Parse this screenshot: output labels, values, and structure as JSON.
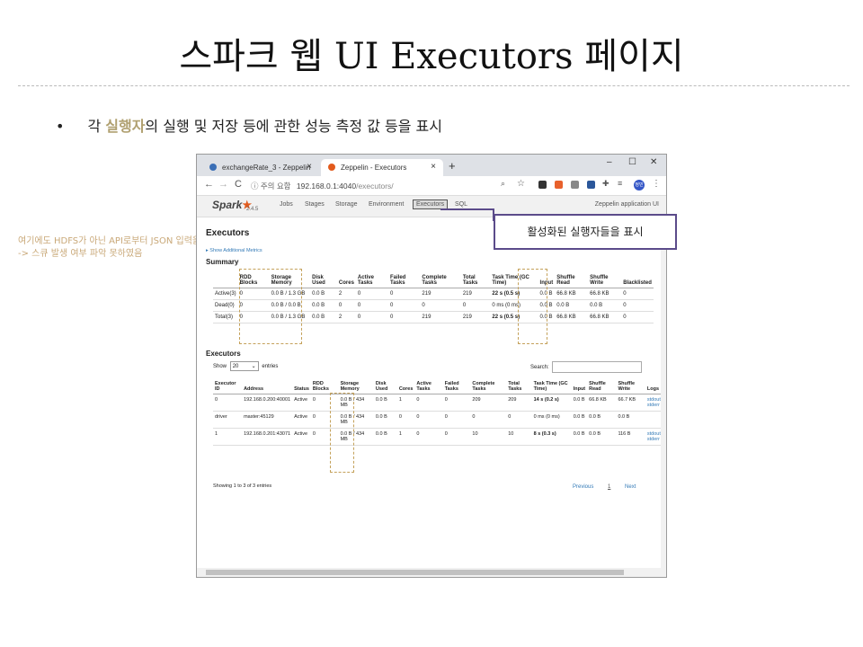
{
  "slide": {
    "title": "스파크 웹 UI Executors 페이지",
    "bullet_dot": "•",
    "bullet_prefix": "각 ",
    "bullet_highlight": "실행자",
    "bullet_suffix": "의 실행 및 저장 등에 관한 성능 측정 값 등을 표시",
    "side_note_line1": "여기에도 HDFS가 아닌 API로부터 JSON 입력을 받아서 그런지 입력에 안 찍힘",
    "side_note_line2": "-> 스큐 발생 여부 파악 못하였음",
    "callout_text": "활성화된 실행자들을 표시"
  },
  "browser": {
    "tab1_title": "exchangeRate_3 - Zeppelin",
    "tab2_title": "Zeppelin - Executors",
    "tab_close": "×",
    "new_tab": "+",
    "min": "–",
    "max": "☐",
    "close": "✕",
    "back": "←",
    "forward": "→",
    "reload": "C",
    "security_label": "ⓘ 주의 요함",
    "url_host": "192.168.0.1:4040",
    "url_path": "/executors/",
    "profile": "정민"
  },
  "spark": {
    "logo": "Spark",
    "version": "2.4.5",
    "nav": [
      "Jobs",
      "Stages",
      "Storage",
      "Environment",
      "Executors",
      "SQL"
    ],
    "app_name": "Zeppelin application UI",
    "page_title": "Executors",
    "additional_metrics": "▸ Show Additional Metrics",
    "summary_title": "Summary",
    "summary_headers": [
      "",
      "RDD Blocks",
      "Storage Memory",
      "Disk Used",
      "Cores",
      "Active Tasks",
      "Failed Tasks",
      "Complete Tasks",
      "Total Tasks",
      "Task Time (GC Time)",
      "Input",
      "Shuffle Read",
      "Shuffle Write",
      "Blacklisted"
    ],
    "summary_rows": [
      [
        "Active(3)",
        "0",
        "0.0 B / 1.3 GB",
        "0.0 B",
        "2",
        "0",
        "0",
        "219",
        "219",
        "22 s (0.5 s)",
        "0.0 B",
        "66.8 KB",
        "66.8 KB",
        "0"
      ],
      [
        "Dead(0)",
        "0",
        "0.0 B / 0.0 B",
        "0.0 B",
        "0",
        "0",
        "0",
        "0",
        "0",
        "0 ms (0 ms)",
        "0.0 B",
        "0.0 B",
        "0.0 B",
        "0"
      ],
      [
        "Total(3)",
        "0",
        "0.0 B / 1.3 GB",
        "0.0 B",
        "2",
        "0",
        "0",
        "219",
        "219",
        "22 s (0.5 s)",
        "0.0 B",
        "66.8 KB",
        "66.8 KB",
        "0"
      ]
    ],
    "executors_title": "Executors",
    "show_label": "Show",
    "show_value": "20",
    "entries_label": "entries",
    "search_label": "Search:",
    "exec_headers": [
      "Executor ID",
      "Address",
      "Status",
      "RDD Blocks",
      "Storage Memory",
      "Disk Used",
      "Cores",
      "Active Tasks",
      "Failed Tasks",
      "Complete Tasks",
      "Total Tasks",
      "Task Time (GC Time)",
      "Input",
      "Shuffle Read",
      "Shuffle Write",
      "Logs"
    ],
    "exec_rows": [
      [
        "0",
        "192.168.0.200:40001",
        "Active",
        "0",
        "0.0 B / 434 MB",
        "0.0 B",
        "1",
        "0",
        "0",
        "209",
        "209",
        "14 s (0.2 s)",
        "0.0 B",
        "66.8 KB",
        "66.7 KB",
        "stdout stderr"
      ],
      [
        "driver",
        "master:45129",
        "Active",
        "0",
        "0.0 B / 434 MB",
        "0.0 B",
        "0",
        "0",
        "0",
        "0",
        "0",
        "0 ms (0 ms)",
        "0.0 B",
        "0.0 B",
        "0.0 B",
        ""
      ],
      [
        "1",
        "192.168.0.201:43071",
        "Active",
        "0",
        "0.0 B / 434 MB",
        "0.0 B",
        "1",
        "0",
        "0",
        "10",
        "10",
        "8 s (0.3 s)",
        "0.0 B",
        "0.0 B",
        "116 B",
        "stdout stderr"
      ]
    ],
    "showing_info": "Showing 1 to 3 of 3 entries",
    "pager": [
      "Previous",
      "1",
      "Next"
    ]
  },
  "colors": {
    "highlight": "#b0a070",
    "callout_border": "#5b4b8a",
    "dash_highlight": "#c4a15a",
    "link": "#337ab7"
  }
}
